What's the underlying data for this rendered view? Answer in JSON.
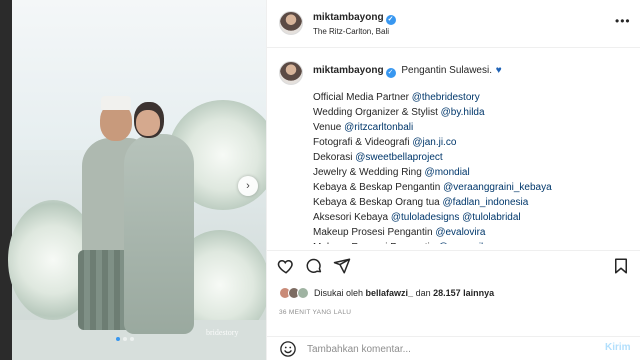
{
  "header": {
    "username": "miktambayong",
    "location": "The Ritz-Carlton, Bali"
  },
  "media": {
    "watermark": "bridestory",
    "carousel_total": 3,
    "carousel_active": 1
  },
  "caption": {
    "username": "miktambayong",
    "text": "Pengantin Sulawesi.",
    "lines": [
      {
        "label": "Official Media Partner",
        "mention": "@thebridestory"
      },
      {
        "label": "Wedding Organizer & Stylist",
        "mention": "@by.hilda"
      },
      {
        "label": "Venue",
        "mention": "@ritzcarltonbali"
      },
      {
        "label": "Fotografi & Videografi",
        "mention": "@jan.ji.co"
      },
      {
        "label": "Dekorasi",
        "mention": "@sweetbellaproject"
      },
      {
        "label": "Jewelry & Wedding Ring",
        "mention": "@mondial"
      },
      {
        "label": "Kebaya & Beskap Pengantin",
        "mention": "@veraanggraini_kebaya"
      },
      {
        "label": "Kebaya & Beskap Orang tua",
        "mention": "@fadlan_indonesia"
      },
      {
        "label": "Aksesori Kebaya",
        "mention": "@tuloladesigns @tulolabridal"
      },
      {
        "label": "Makeup Prosesi Pengantin",
        "mention": "@evalovira"
      },
      {
        "label": "Makeup Resepsi Pengantin",
        "mention": "@ryanogilvy"
      }
    ]
  },
  "likes": {
    "prefix": "Disukai oleh",
    "user": "bellafawzi_",
    "connector": "dan",
    "count": "28.157 lainnya"
  },
  "timestamp": "36 MENIT YANG LALU",
  "comment": {
    "placeholder": "Tambahkan komentar...",
    "post_label": "Kirim"
  },
  "colors": {
    "link": "#00376b",
    "verified": "#3897f0",
    "post_disabled": "#b2dffc"
  }
}
